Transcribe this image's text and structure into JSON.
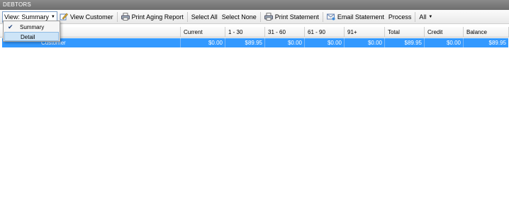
{
  "window": {
    "title": "DEBTORS"
  },
  "toolbar": {
    "view_label": "View: Summary",
    "view_customer": "View Customer",
    "print_aging": "Print Aging Report",
    "select_all": "Select All",
    "select_none": "Select None",
    "print_statement": "Print Statement",
    "email_statement": "Email Statement",
    "process": "Process",
    "filter": "All"
  },
  "view_menu": {
    "items": [
      {
        "label": "Summary",
        "checked": true
      },
      {
        "label": "Detail",
        "highlighted": true
      }
    ]
  },
  "table": {
    "columns": [
      "",
      "Current",
      "1 - 30",
      "31 - 60",
      "61 - 90",
      "91+",
      "Total",
      "Credit",
      "Balance"
    ],
    "rows": [
      {
        "name": "Customer",
        "current": "$0.00",
        "d1_30": "$89.95",
        "d31_60": "$0.00",
        "d61_90": "$0.00",
        "d91": "$0.00",
        "total": "$89.95",
        "credit": "$0.00",
        "balance": "$89.95"
      }
    ]
  },
  "colors": {
    "selection": "#3399ff",
    "titlebar": "#7c7c7c"
  }
}
